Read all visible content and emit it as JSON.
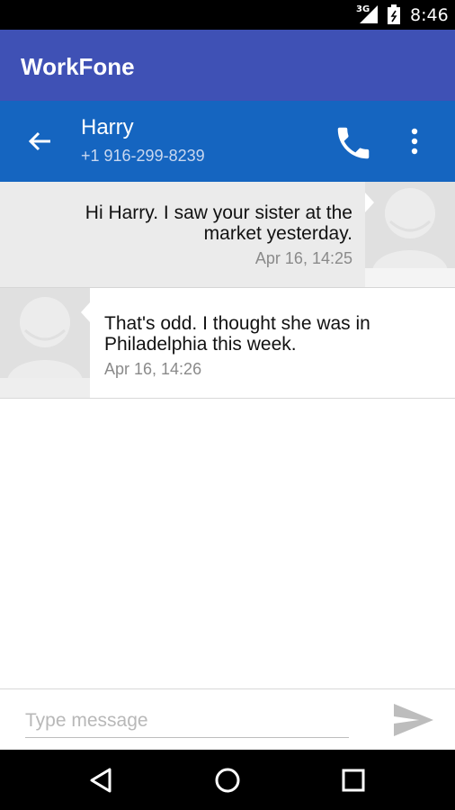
{
  "status_bar": {
    "network": "3G",
    "time": "8:46"
  },
  "app": {
    "title": "WorkFone"
  },
  "conversation": {
    "contact_name": "Harry",
    "contact_number": "+1 916-299-8239"
  },
  "messages": [
    {
      "direction": "outgoing",
      "text": "Hi Harry. I saw your sister at the market yesterday.",
      "time": "Apr 16, 14:25"
    },
    {
      "direction": "incoming",
      "text": "That's odd. I thought she was in Philadelphia this week.",
      "time": "Apr 16, 14:26"
    }
  ],
  "composer": {
    "placeholder": "Type message",
    "value": ""
  },
  "icons": {
    "back": "arrow-left-icon",
    "call": "phone-icon",
    "more": "more-vert-icon",
    "send": "send-icon",
    "nav_back": "triangle-back-icon",
    "nav_home": "circle-home-icon",
    "nav_recents": "square-recents-icon"
  },
  "colors": {
    "app_bar": "#3f51b5",
    "toolbar": "#1565c0",
    "outgoing_bg": "#ebebeb",
    "incoming_bg": "#ffffff"
  }
}
